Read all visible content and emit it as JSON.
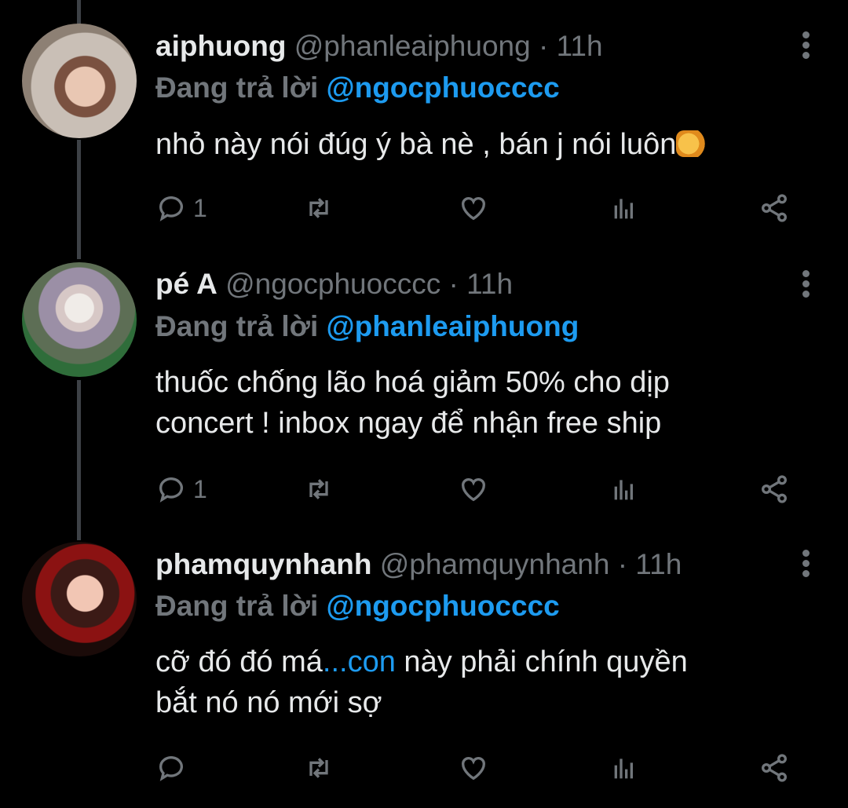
{
  "replies": [
    {
      "name": "aiphuong",
      "handle": "@phanleaiphuong",
      "time": "11h",
      "replying_prefix": "Đang trả lời",
      "replying_to": "@ngocphuocccc",
      "text": "nhỏ này nói đúg ý bà nè , bán j nói luôn",
      "reply_count": "1"
    },
    {
      "name": "pé A",
      "handle": "@ngocphuocccc",
      "time": "11h",
      "replying_prefix": "Đang trả lời",
      "replying_to": "@phanleaiphuong",
      "text_line1": "thuốc chống lão hoá giảm 50% cho dịp",
      "text_line2": "concert ! inbox ngay để nhận free ship",
      "reply_count": "1"
    },
    {
      "name": "phamquynhanh",
      "handle": "@phamquynhanh",
      "time": "11h",
      "replying_prefix": "Đang trả lời",
      "replying_to": "@ngocphuocccc",
      "text_a": "cỡ đó đó má",
      "text_link": "...con",
      "text_b": " này phải chính quyền",
      "text_line2": "bắt nó nó mới sợ",
      "reply_count": ""
    }
  ],
  "separator": "·",
  "icons": [
    "more-icon",
    "reply-icon",
    "retweet-icon",
    "like-icon",
    "views-icon",
    "share-icon",
    "fist-emoji"
  ],
  "colors": {
    "background": "#000000",
    "text": "#e7e9ea",
    "muted": "#71767b",
    "accent": "#1d9bf0"
  }
}
